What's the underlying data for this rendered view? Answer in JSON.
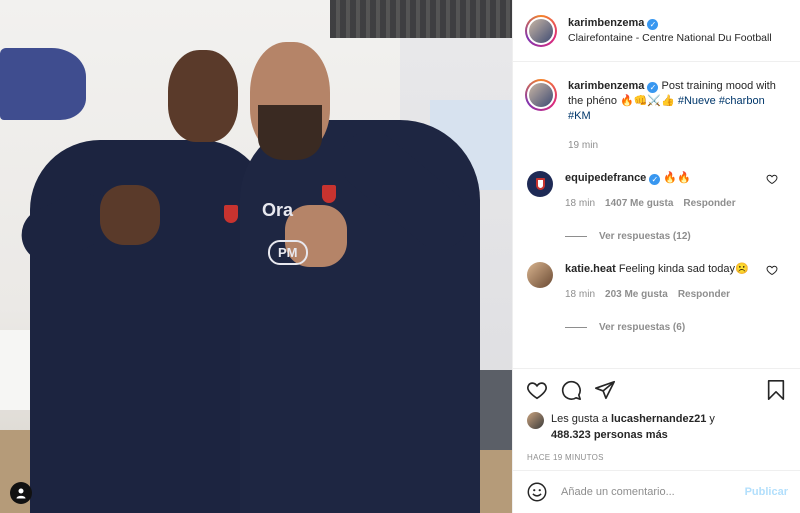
{
  "post": {
    "username": "karimbenzema",
    "location": "Clairefontaine - Centre National Du Football",
    "caption": {
      "text": "Post training mood with the phéno 🔥👊⚔️👍",
      "hashtags": "#Nueve #charbon #KM",
      "time": "19 min"
    }
  },
  "comments": [
    {
      "username": "equipedefrance",
      "text": "🔥🔥",
      "time": "18 min",
      "likes": "1407 Me gusta",
      "reply": "Responder",
      "view_replies": "Ver respuestas (12)",
      "avatar_icon": "france-crest-icon"
    },
    {
      "username": "katie.heat",
      "text": "Feeling kinda sad today☹️",
      "time": "18 min",
      "likes": "203 Me gusta",
      "reply": "Responder",
      "view_replies": "Ver respuestas (6)",
      "avatar_icon": "user-avatar"
    }
  ],
  "likes_line": {
    "prefix": "Les gusta a",
    "user": "lucashernandez21",
    "suffix": "y",
    "others": "488.323 personas más"
  },
  "timestamp": "Hace 19 minutos",
  "add_comment": {
    "placeholder": "Añade un comentario...",
    "publish_label": "Publicar"
  },
  "photo_text": {
    "sponsor_top": "Ora",
    "sponsor_badge": "PM"
  },
  "colors": {
    "hashtag": "#00376b",
    "verified": "#3897f0",
    "muted": "#8e8e8e",
    "publish_disabled": "#b2dffc"
  }
}
